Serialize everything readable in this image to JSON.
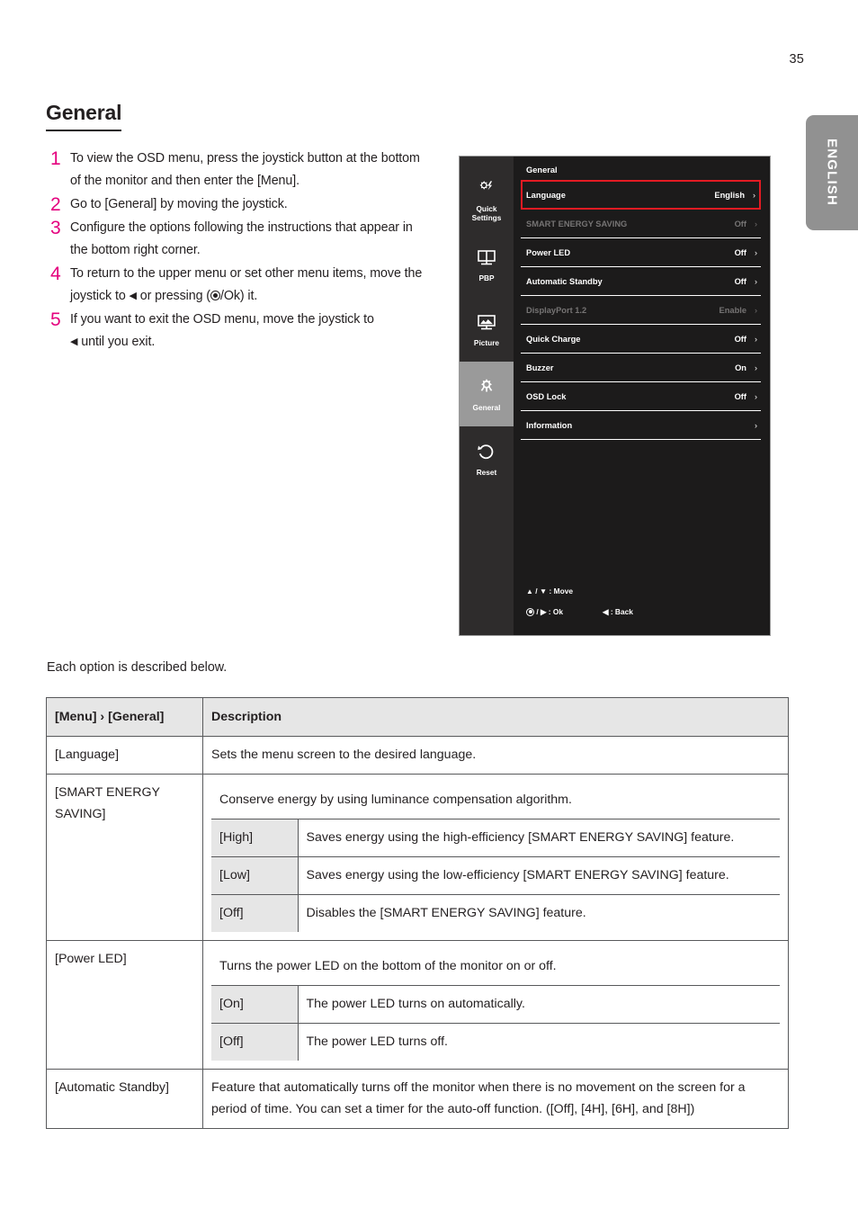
{
  "page": {
    "number": "35",
    "language_tab": "ENGLISH",
    "heading": "General",
    "caption": "Each option is described below."
  },
  "steps": [
    {
      "num": "1",
      "text_before": "To view the OSD menu, press the joystick button at the bottom of the monitor and then enter the [Menu]."
    },
    {
      "num": "2",
      "text_before": "Go to [General] by moving the joystick."
    },
    {
      "num": "3",
      "text_before": "Configure the options following the instructions that appear in the bottom right corner."
    },
    {
      "num": "4",
      "text_before": "To return to the upper menu or set other menu items, move the joystick to ",
      "text_mid": " or pressing (",
      "text_after": "/Ok) it."
    },
    {
      "num": "5",
      "text_before": "If you want to exit the OSD menu, move the joystick to ",
      "text_after": " until you exit."
    }
  ],
  "osd": {
    "title": "General",
    "sidebar": [
      {
        "label_line1": "Quick",
        "label_line2": "Settings",
        "icon": "quick-settings-icon",
        "active": false
      },
      {
        "label_line1": "PBP",
        "label_line2": "",
        "icon": "pbp-icon",
        "active": false
      },
      {
        "label_line1": "Picture",
        "label_line2": "",
        "icon": "picture-icon",
        "active": false
      },
      {
        "label_line1": "General",
        "label_line2": "",
        "icon": "gear-icon",
        "active": true
      },
      {
        "label_line1": "Reset",
        "label_line2": "",
        "icon": "reset-icon",
        "active": false
      }
    ],
    "rows": [
      {
        "label": "Language",
        "value": "English",
        "arrow": "›",
        "state": "selected"
      },
      {
        "label": "SMART ENERGY SAVING",
        "value": "Off",
        "arrow": "›",
        "state": "dim"
      },
      {
        "label": "Power LED",
        "value": "Off",
        "arrow": "›",
        "state": "normal"
      },
      {
        "label": "Automatic Standby",
        "value": "Off",
        "arrow": "›",
        "state": "normal"
      },
      {
        "label": "DisplayPort 1.2",
        "value": "Enable",
        "arrow": "›",
        "state": "dim"
      },
      {
        "label": "Quick Charge",
        "value": "Off",
        "arrow": "›",
        "state": "normal"
      },
      {
        "label": "Buzzer",
        "value": "On",
        "arrow": "›",
        "state": "normal"
      },
      {
        "label": "OSD Lock",
        "value": "Off",
        "arrow": "›",
        "state": "normal"
      },
      {
        "label": "Information",
        "value": "",
        "arrow": "›",
        "state": "normal"
      }
    ],
    "hints": {
      "move": "/ ▼ : Move",
      "move_up": "▲",
      "ok": "/ ▶ : Ok",
      "back": "◀ : Back"
    },
    "colors": {
      "selection_border": "#e31b23",
      "panel_bg": "#1c1b1b",
      "sidebar_bg": "#2e2c2c",
      "active_tab_bg": "#9a9a9a",
      "dim_text": "#767474"
    }
  },
  "table": {
    "headers": {
      "col1": "[Menu] › [General]",
      "col2": "Description"
    },
    "rows": [
      {
        "name": "[Language]",
        "description": "Sets the menu screen to the desired language.",
        "sub": []
      },
      {
        "name": "[SMART ENERGY SAVING]",
        "description": "Conserve energy by using luminance compensation algorithm.",
        "sub": [
          {
            "label": "[High]",
            "text": "Saves energy using the high-efficiency [SMART ENERGY SAVING] feature."
          },
          {
            "label": "[Low]",
            "text": "Saves energy using the low-efficiency [SMART ENERGY SAVING] feature."
          },
          {
            "label": "[Off]",
            "text": "Disables the [SMART ENERGY SAVING] feature."
          }
        ]
      },
      {
        "name": "[Power LED]",
        "description": "Turns the power LED on the bottom of the monitor on or off.",
        "sub": [
          {
            "label": "[On]",
            "text": "The power LED turns on automatically."
          },
          {
            "label": "[Off]",
            "text": "The power LED turns off."
          }
        ]
      },
      {
        "name": "[Automatic Standby]",
        "description": "Feature that automatically turns off the monitor when there is no movement on the screen for a period of time. You can set a timer for the auto-off function. ([Off], [4H], [6H], and [8H])",
        "sub": []
      }
    ]
  },
  "colors": {
    "accent_pink": "#e4007e",
    "text": "#231f20",
    "table_header_bg": "#e6e6e6",
    "tab_gray": "#919191"
  }
}
